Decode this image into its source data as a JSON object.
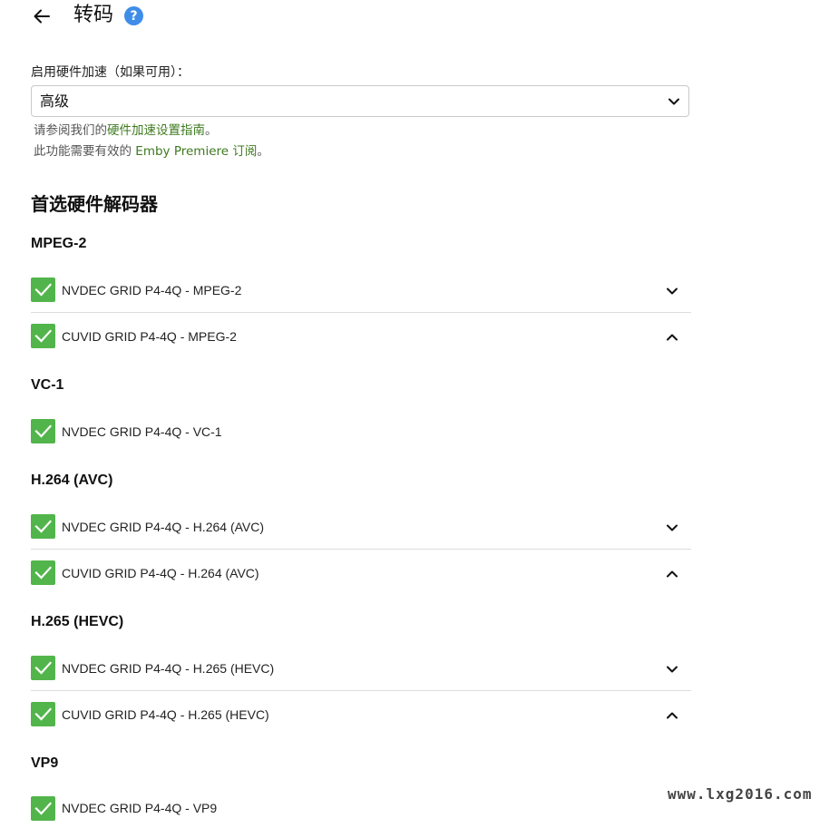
{
  "header": {
    "title": "转码",
    "back_icon": "arrow-left-icon",
    "help_icon": "help-circle-icon",
    "help_glyph": "?"
  },
  "hardware_acceleration": {
    "label": "启用硬件加速（如果可用）：",
    "selected_value": "高级",
    "help_line1_prefix": "请参阅我们的",
    "help_line1_link": "硬件加速设置指南",
    "help_line1_suffix": "。",
    "help_line2_prefix": "此功能需要有效的 ",
    "help_line2_link": "Emby Premiere 订阅",
    "help_line2_suffix": "。",
    "link_color": "#3d7a1f"
  },
  "preferred_decoders": {
    "title": "首选硬件解码器",
    "checkbox_color": "#52b54b",
    "groups": [
      {
        "codec": "MPEG-2",
        "decoders": [
          {
            "label": "NVDEC GRID P4-4Q - MPEG-2",
            "checked": true,
            "chevron": "chevron-down-icon"
          },
          {
            "label": "CUVID GRID P4-4Q - MPEG-2",
            "checked": true,
            "chevron": "chevron-up-icon"
          }
        ]
      },
      {
        "codec": "VC-1",
        "decoders": [
          {
            "label": "NVDEC GRID P4-4Q - VC-1",
            "checked": true
          }
        ]
      },
      {
        "codec": "H.264 (AVC)",
        "decoders": [
          {
            "label": "NVDEC GRID P4-4Q - H.264 (AVC)",
            "checked": true,
            "chevron": "chevron-down-icon"
          },
          {
            "label": "CUVID GRID P4-4Q - H.264 (AVC)",
            "checked": true,
            "chevron": "chevron-up-icon"
          }
        ]
      },
      {
        "codec": "H.265 (HEVC)",
        "decoders": [
          {
            "label": "NVDEC GRID P4-4Q - H.265 (HEVC)",
            "checked": true,
            "chevron": "chevron-down-icon"
          },
          {
            "label": "CUVID GRID P4-4Q - H.265 (HEVC)",
            "checked": true,
            "chevron": "chevron-up-icon"
          }
        ]
      },
      {
        "codec": "VP9",
        "decoders": [
          {
            "label": "NVDEC GRID P4-4Q - VP9",
            "checked": true
          }
        ]
      }
    ]
  },
  "watermark": "www.lxg2016.com"
}
